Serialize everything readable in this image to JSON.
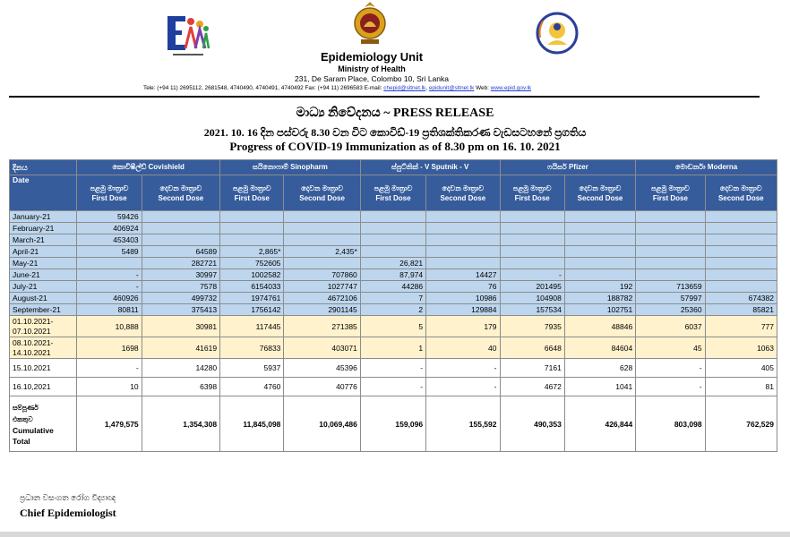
{
  "header": {
    "unit": "Epidemiology Unit",
    "ministry": "Ministry of Health",
    "address": "231, De Saram Place, Colombo 10, Sri Lanka",
    "contact_prefix": "Tele: (+94 11) 2695112, 2681548, 4740490, 4740491, 4740492 Fax: (+94 11) 2696583 E-mail: ",
    "email1": "chepid@sltnet.lk",
    "email2": "epidunit@sltnet.lk",
    "web_prefix": " Web: ",
    "web": "www.epid.gov.lk"
  },
  "titles": {
    "line1": "මාධ්‍ය නිවේදනය ~ PRESS RELEASE",
    "line2": "2021. 10. 16 දින පස්වරු 8.30 වන විට කොවිඩ්-19 ප්‍රතිශක්තිකරණ වැඩසටහනේ ප්‍රගතිය",
    "line3": "Progress of COVID-19 Immunization as of 8.30 pm on 16. 10. 2021"
  },
  "table": {
    "date_header_si": "දිනය",
    "date_header_en": "Date",
    "vaccines": [
      {
        "si": "කොවිෂීල්ඩ්",
        "en": "Covishield"
      },
      {
        "si": "සයිනොෆාම්",
        "en": "Sinopharm"
      },
      {
        "si": "ස්පුට්නික් - V",
        "en": "Sputnik - V"
      },
      {
        "si": "ෆයිසර්",
        "en": "Pfizer"
      },
      {
        "si": "මොඩර්නා",
        "en": "Moderna"
      }
    ],
    "first_dose_si": "පළමු මාත්‍රාව",
    "first_dose_en": "First Dose",
    "second_dose_si": "දෙවන මාත්‍රාව",
    "second_dose_en": "Second Dose",
    "rows": [
      {
        "style": "b",
        "date": "January-21",
        "v": [
          "59426",
          "",
          "",
          "",
          "",
          "",
          "",
          "",
          "",
          ""
        ]
      },
      {
        "style": "b",
        "date": "February-21",
        "v": [
          "406924",
          "",
          "",
          "",
          "",
          "",
          "",
          "",
          "",
          ""
        ]
      },
      {
        "style": "b",
        "date": "March-21",
        "v": [
          "453403",
          "",
          "",
          "",
          "",
          "",
          "",
          "",
          "",
          ""
        ]
      },
      {
        "style": "b",
        "date": "April-21",
        "v": [
          "5489",
          "64589",
          "2,865*",
          "2,435*",
          "",
          "",
          "",
          "",
          "",
          ""
        ]
      },
      {
        "style": "b",
        "date": "May-21",
        "v": [
          "",
          "282721",
          "752605",
          "",
          "26,821",
          "",
          "",
          "",
          "",
          ""
        ]
      },
      {
        "style": "b",
        "date": "June-21",
        "v": [
          "-",
          "30997",
          "1002582",
          "707860",
          "87,974",
          "14427",
          "-",
          "",
          "",
          ""
        ]
      },
      {
        "style": "b",
        "date": "July-21",
        "v": [
          "-",
          "7578",
          "6154033",
          "1027747",
          "44286",
          "76",
          "201495",
          "192",
          "713659",
          ""
        ]
      },
      {
        "style": "b",
        "date": "August-21",
        "v": [
          "460926",
          "499732",
          "1974761",
          "4672106",
          "7",
          "10986",
          "104908",
          "188782",
          "57997",
          "674382"
        ]
      },
      {
        "style": "b",
        "date": "September-21",
        "v": [
          "80811",
          "375413",
          "1756142",
          "2901145",
          "2",
          "129884",
          "157534",
          "102751",
          "25360",
          "85821"
        ]
      },
      {
        "style": "y",
        "date": "01.10.2021-",
        "date2": "07.10.2021",
        "v": [
          "10,888",
          "30981",
          "117445",
          "271385",
          "5",
          "179",
          "7935",
          "48846",
          "6037",
          "777"
        ]
      },
      {
        "style": "y",
        "date": "08.10.2021-",
        "date2": "14.10.2021",
        "v": [
          "1698",
          "41619",
          "76833",
          "403071",
          "1",
          "40",
          "6648",
          "84604",
          "45",
          "1063"
        ]
      },
      {
        "style": "w",
        "date": "15.10.2021",
        "v": [
          "-",
          "14280",
          "5937",
          "45396",
          "-",
          "-",
          "7161",
          "628",
          "-",
          "405"
        ]
      },
      {
        "style": "w",
        "date": "16.10,2021",
        "v": [
          "10",
          "6398",
          "4760",
          "40776",
          "-",
          "-",
          "4672",
          "1041",
          "-",
          "81"
        ]
      }
    ],
    "total": {
      "label_si_1": "සම්පූර්ණ",
      "label_si_2": "එකතුව",
      "label_en_1": "Cumulative",
      "label_en_2": "Total",
      "v": [
        "1,479,575",
        "1,354,308",
        "11,845,098",
        "10,069,486",
        "159,096",
        "155,592",
        "490,353",
        "426,844",
        "803,098",
        "762,529"
      ]
    }
  },
  "signature": {
    "line1": "ප්‍රධාන වසංගත රෝග විද්‍යාඥ",
    "line2": "Chief Epidemiologist"
  },
  "colors": {
    "header_blue": "#365c9c",
    "row_blue": "#bdd6ee",
    "row_yellow": "#fff2cc"
  }
}
